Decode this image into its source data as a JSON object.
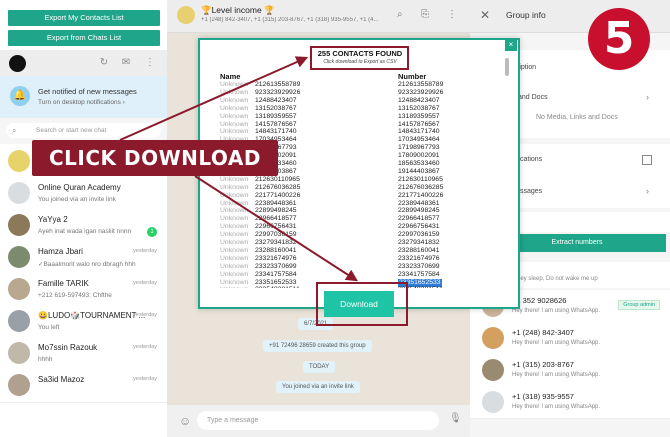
{
  "extension": {
    "export_contacts_label": "Export My Contacts List",
    "export_chats_label": "Export from Chats List"
  },
  "notification": {
    "title": "Get notified of new messages",
    "subtitle": "Turn on desktop notifications ›"
  },
  "search": {
    "placeholder": "Search or start new chat"
  },
  "chats": [
    {
      "name": "🏆Level income 🏆",
      "preview": "You joined via an invite link",
      "time": "",
      "badge": ""
    },
    {
      "name": "Online Quran Academy",
      "preview": "You joined via an invite link",
      "time": "",
      "badge": ""
    },
    {
      "name": "YaYya 2",
      "preview": "Ayeh inat wada igan nasliit nnnn",
      "time": "",
      "badge": "1"
    },
    {
      "name": "Hamza Jbari",
      "preview": "✓Baaalmorit walo nro dbragh hhh",
      "time": "yesterday",
      "badge": ""
    },
    {
      "name": "Famille TARIK",
      "preview": "+212 619-597493: Chfthe",
      "time": "yesterday",
      "badge": ""
    },
    {
      "name": "😀LUDO🎲TOURNAMENT ...",
      "preview": "You left",
      "time": "yesterday",
      "badge": ""
    },
    {
      "name": "Mo7ssin Razouk",
      "preview": "hhhh",
      "time": "yesterday",
      "badge": ""
    },
    {
      "name": "Sa3id Mazoz",
      "preview": "",
      "time": "yesterday",
      "badge": ""
    }
  ],
  "chat_header": {
    "title": "🏆Level income 🏆",
    "subtitle": "+1 (248) 842-3407, +1 (315) 203-8767, +1 (318) 935-9557, +1 (4..."
  },
  "chat_messages": [
    "6/7/2021",
    "+91 72496 28659 created this group",
    "TODAY",
    "You joined via an invite link"
  ],
  "composer": {
    "placeholder": "Type a message"
  },
  "group_info": {
    "title": "Group info",
    "description_label": "scription",
    "media_label": "and Docs",
    "no_media_text": "No Media, Links and Docs",
    "notifications_label": "cations",
    "starred_label": "ssages",
    "participants_label": "s",
    "extract_label": "Extract numbers",
    "you_status": "Hey sleep, Do not wake me up"
  },
  "members": [
    {
      "name": "+1 352 9028626",
      "status": "Hey there! I am using WhatsApp.",
      "admin": "Group admin"
    },
    {
      "name": "+1 (248) 842-3407",
      "status": "Hey there! I am using WhatsApp.",
      "admin": ""
    },
    {
      "name": "+1 (315) 203-8767",
      "status": "Hey there! I am using WhatsApp.",
      "admin": ""
    },
    {
      "name": "+1 (318) 935-9557",
      "status": "Hey there! I am using WhatsApp.",
      "admin": ""
    }
  ],
  "step_number": "5",
  "modal": {
    "found_title": "255 CONTACTS FOUND",
    "found_subtitle": "Click download to Export as CSV",
    "col_name": "Name",
    "col_number": "Number",
    "unknown_label": "Unknown",
    "download_label": "Download",
    "close_label": "×",
    "numbers": [
      "212613558789",
      "923323929926",
      "12488423407",
      "13152038767",
      "13189359557",
      "14157876567",
      "14843171740",
      "17034953464",
      "17198967793",
      "17809002091",
      "18563533460",
      "19144403867",
      "212630110965",
      "212676036285",
      "221771400226",
      "22389448361",
      "22899498245",
      "22966418577",
      "22966756431",
      "22997036159",
      "23279341832",
      "23288160041",
      "23321674976",
      "23323370699",
      "23341757584",
      "23351652533",
      "233548381511"
    ],
    "highlight_index": 25
  },
  "annotation": {
    "label": "CLICK DOWNLOAD"
  },
  "colors": {
    "accent": "#1fa58a",
    "annotation": "#8b1a2c",
    "badge": "#c8102e"
  }
}
